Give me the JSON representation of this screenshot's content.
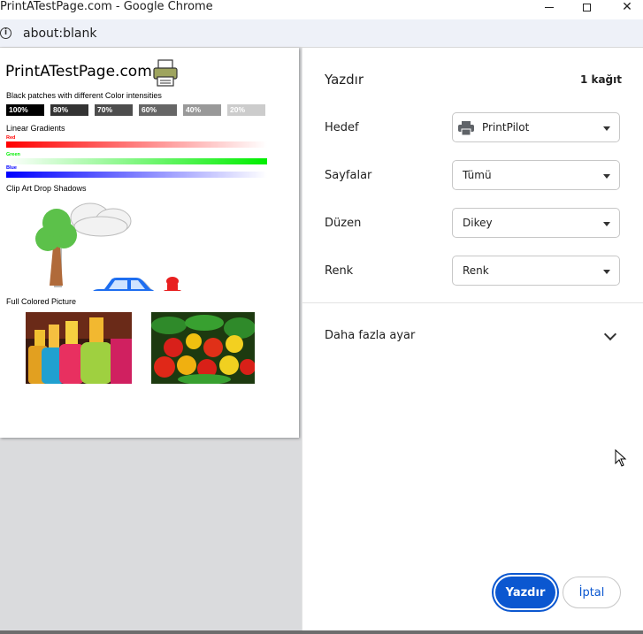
{
  "window": {
    "title": "PrintATestPage.com - Google Chrome",
    "address": "about:blank"
  },
  "preview": {
    "brand": "PrintATestPage.com",
    "sections": {
      "patches_label": "Black patches with different Color intensities",
      "gradients_label": "Linear Gradients",
      "clipart_label": "Clip Art Drop Shadows",
      "picture_label": "Full Colored Picture"
    },
    "patches": [
      {
        "label": "100%",
        "color": "#000000"
      },
      {
        "label": "80%",
        "color": "#333333"
      },
      {
        "label": "70%",
        "color": "#4d4d4d"
      },
      {
        "label": "60%",
        "color": "#666666"
      },
      {
        "label": "40%",
        "color": "#999999"
      },
      {
        "label": "20%",
        "color": "#cccccc"
      }
    ],
    "gradients": [
      {
        "label": "Red",
        "color": "#ff0000"
      },
      {
        "label": "Green",
        "color": "#00ee00"
      },
      {
        "label": "Blue",
        "color": "#0000ff"
      }
    ]
  },
  "panel": {
    "title": "Yazdır",
    "sheet_count": "1 kağıt",
    "rows": [
      {
        "label": "Hedef",
        "value": "PrintPilot"
      },
      {
        "label": "Sayfalar",
        "value": "Tümü"
      },
      {
        "label": "Düzen",
        "value": "Dikey"
      },
      {
        "label": "Renk",
        "value": "Renk"
      }
    ],
    "more_settings": "Daha fazla ayar",
    "print_button": "Yazdır",
    "cancel_button": "İptal"
  },
  "colors": {
    "accent": "#0b57d0",
    "preview_bg": "#dadbdd"
  }
}
